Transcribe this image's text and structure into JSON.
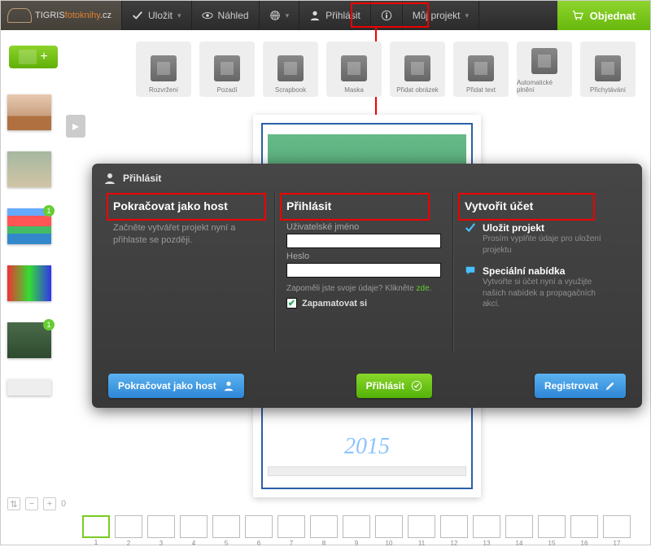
{
  "logo": {
    "brand_prefix": "TIGRIS",
    "brand_main": "fotoknihy",
    "brand_tld": ".cz"
  },
  "topbar": {
    "save": "Uložit",
    "preview": "Náhled",
    "globe": "",
    "login": "Přihlásit",
    "info": "",
    "myproject": "Můj projekt",
    "order": "Objednat"
  },
  "tools": [
    {
      "label": "Rozvržení"
    },
    {
      "label": "Pozadí"
    },
    {
      "label": "Scrapbook"
    },
    {
      "label": "Maska"
    },
    {
      "label": "Přidat obrázek"
    },
    {
      "label": "Přidat text"
    },
    {
      "label": "Automatické plnění"
    },
    {
      "label": "Přichytávání"
    }
  ],
  "addmore": "+",
  "modal": {
    "title": "Přihlásit",
    "guest": {
      "heading": "Pokračovat jako host",
      "desc": "Začněte vytvářet projekt nyní a přihlaste se později.",
      "btn": "Pokračovat jako host"
    },
    "login": {
      "heading": "Přihlásit",
      "user_label": "Uživatelské jméno",
      "pass_label": "Heslo",
      "forgot_pre": "Zapoměli jste svoje údaje? Klikněte ",
      "forgot_link": "zde",
      "remember": "Zapamatovat si",
      "btn": "Přihlásit"
    },
    "create": {
      "heading": "Vytvořit účet",
      "b1_head": "Uložit projekt",
      "b1_sub": "Prosím vyplňte údaje pro uložení projektu",
      "b2_head": "Speciální nabídka",
      "b2_sub": "Vytvořte si účet nyní a využijte našich nabídek a propagačních akcí.",
      "btn": "Registrovat"
    }
  },
  "page_year": "2015",
  "filmstrip": {
    "count": 17,
    "selected": 1
  }
}
